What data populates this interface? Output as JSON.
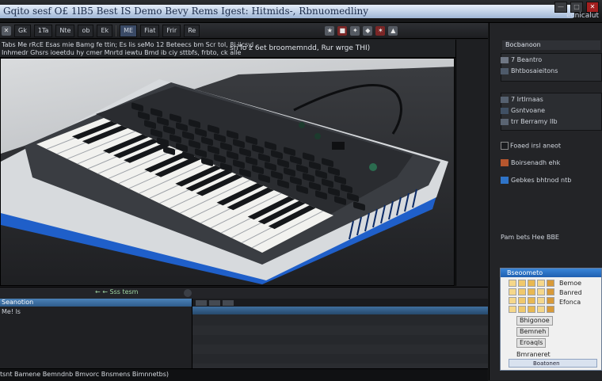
{
  "window": {
    "title": "Gqito sesf O£ 1lB5 Best IS Demo Bevy Rems Igest: Hitmids-, Rbnuomedliny",
    "controls": [
      "—",
      "□",
      "✕"
    ],
    "top_right_label": "ecnicalut"
  },
  "toolbar": {
    "items": [
      {
        "icon": "x-icon",
        "label": "Gk"
      },
      {
        "icon": "",
        "label": "1Ta"
      },
      {
        "icon": "",
        "label": "Nte"
      },
      {
        "icon": "",
        "label": "ob"
      },
      {
        "icon": "",
        "label": "Ek"
      },
      {
        "icon": "",
        "label": "Fiat"
      }
    ],
    "active_label": "ME",
    "right_labels": [
      "Fiat",
      "Frir",
      "Re"
    ],
    "icon_labels": [
      "★",
      "■",
      "✦",
      "◆",
      "✶",
      "▲"
    ]
  },
  "info": {
    "line1": "Tabs Me rRcE Esas mie Bamg fe ttin; Es lis seMo 12 Beteecs bm Scr tol, 8i iicsyl",
    "line2": "Inhmedr Ghsrs ioeetdu hy cmer Mnrtd iewtu Bmd ib ciy sttbfs, frbto, ck alle",
    "tags": "sri'lo z 6et broomemndd, Rur wrge THI)"
  },
  "viewport": {
    "colors": {
      "body": "#3a3d42",
      "deck": "#2a2c30",
      "keys_dark": "#15171a",
      "keys_white": "#f2f2ef",
      "trim": "#1f5fc9",
      "shell": "#d7dadd"
    },
    "white_key_count": 22,
    "black_key_count": 15
  },
  "timeline": {
    "label": "← ← Sss tesm"
  },
  "bottom_left": {
    "header": "Seanotion",
    "item": "Me! ls"
  },
  "status": {
    "text": "tsnt Bamene Bemndnb Bmvorc Bnsmens Bimnnetbs)"
  },
  "right_panel": {
    "tab": "Bocbanoon",
    "rows": [
      {
        "label": "7 Beantro",
        "color": "#6f7784"
      },
      {
        "label": "Bhtbosaieitons",
        "color": "#4e5a6a"
      },
      {
        "label": "7 Irtlrnaas",
        "color": "#566170"
      },
      {
        "label": "Gsntvoane",
        "color": "#405064"
      },
      {
        "label": "trr Berramy Ilb",
        "color": "#5a6472"
      },
      {
        "label": "Foaed irsl aneot",
        "color": "#3b4658"
      },
      {
        "label": "Boirsenadh ehk",
        "color": "#4a5566"
      },
      {
        "label": "Gebkes bhtnod ntb",
        "color": "#566272"
      }
    ],
    "footer": "Pam bets Hee BBE"
  },
  "dialog": {
    "title": "Bseoometo",
    "labels": [
      "Bemoe",
      "Banred",
      "Efonca",
      "Bhigonoe",
      "Bemneh",
      "Eroaqls",
      "Bmraneret"
    ],
    "cell_colors": [
      "#f5d78a",
      "#f0c86c",
      "#e8b852",
      "#f5d78a",
      "#d89a3a"
    ],
    "ok_label": "Boatonen"
  }
}
